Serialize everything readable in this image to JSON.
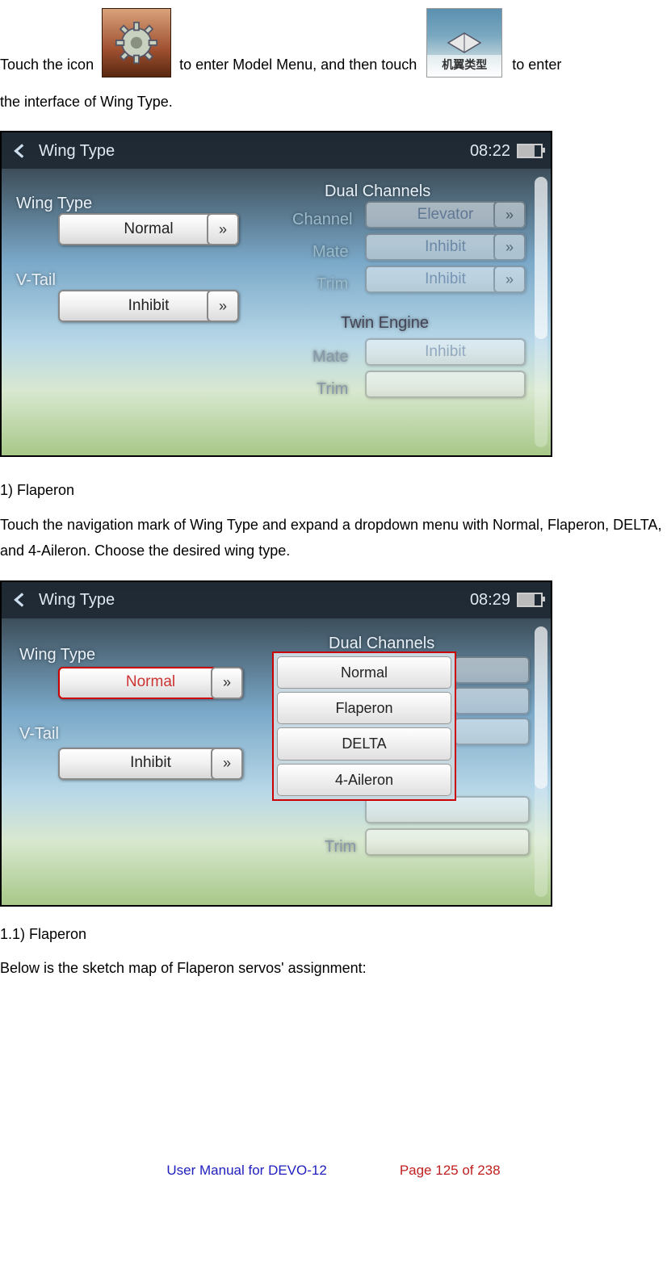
{
  "intro": {
    "part1": "Touch the icon",
    "part2": "to enter Model Menu, and then touch",
    "part3": "to enter",
    "line2": "the interface of Wing Type.",
    "wingtype_icon_label": "机翼类型"
  },
  "screenshot1": {
    "title": "Wing Type",
    "clock": "08:22",
    "wing_type_label": "Wing Type",
    "wing_type_value": "Normal",
    "vtail_label": "V-Tail",
    "vtail_value": "Inhibit",
    "dual_channels_label": "Dual Channels",
    "channel_label": "Channel",
    "channel_value": "Elevator",
    "mate1_label": "Mate",
    "mate1_value": "Inhibit",
    "trim1_label": "Trim",
    "trim1_value": "Inhibit",
    "twin_engine_label": "Twin Engine",
    "mate2_label": "Mate",
    "mate2_value": "Inhibit",
    "trim2_label": "Trim",
    "trim2_value": ""
  },
  "section1_heading": "1)  Flaperon",
  "section1_para": "Touch the navigation mark of Wing Type and expand a dropdown menu with Normal, Flaperon, DELTA, and 4-Aileron. Choose the desired wing type.",
  "screenshot2": {
    "title": "Wing Type",
    "clock": "08:29",
    "wing_type_label": "Wing Type",
    "wing_type_value": "Normal",
    "vtail_label": "V-Tail",
    "vtail_value": "Inhibit",
    "dual_channels_label": "Dual Channels",
    "dropdown": {
      "opt1": "Normal",
      "opt2": "Flaperon",
      "opt3": "DELTA",
      "opt4": "4-Aileron"
    },
    "trim2_label": "Trim"
  },
  "subheading": "1.1) Flaperon",
  "tail_para": "Below is the sketch map of Flaperon servos' assignment:",
  "footer": {
    "title": "User Manual for DEVO-12",
    "page": "Page 125 of 238"
  }
}
